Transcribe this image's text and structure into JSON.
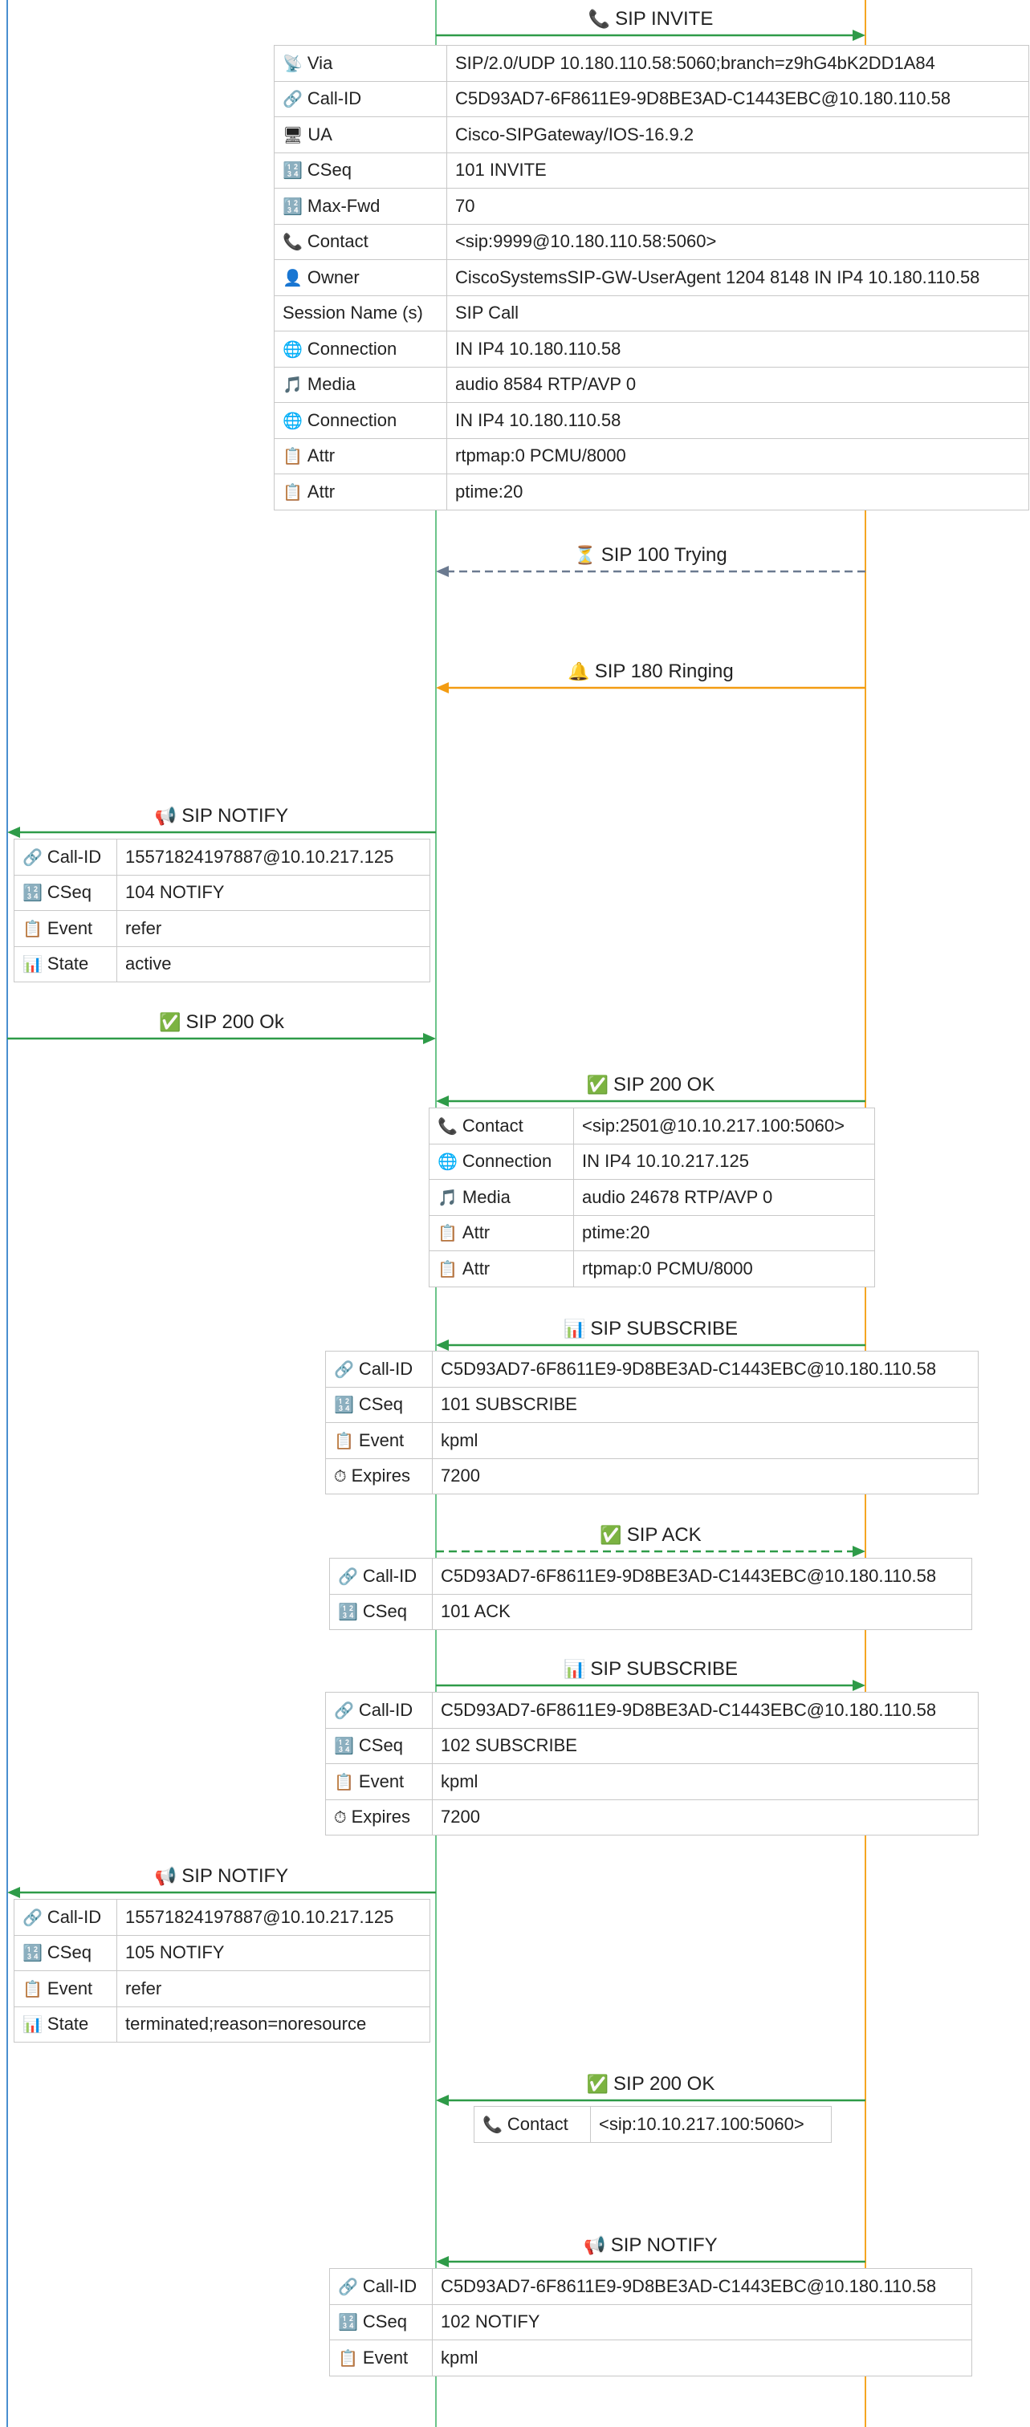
{
  "colors": {
    "left_lifeline": "#4a8fd0",
    "middle_lifeline": "#6cc48a",
    "right_lifeline": "#f5a623",
    "green": "#2e9b48",
    "gray": "#6b7a90",
    "orange": "#f39c12"
  },
  "messages": [
    {
      "id": "m1",
      "label": "SIP INVITE",
      "icon": "phone-icon",
      "glyph": "📞",
      "from": "middle",
      "to": "right",
      "style": "solid",
      "color": "#2e9b48",
      "fields": [
        {
          "icon": "satellite-icon",
          "glyph": "📡",
          "key": "Via",
          "value": "SIP/2.0/UDP 10.180.110.58:5060;branch=z9hG4bK2DD1A84"
        },
        {
          "icon": "link-icon",
          "glyph": "🔗",
          "key": "Call-ID",
          "value": "C5D93AD7-6F8611E9-9D8BE3AD-C1443EBC@10.180.110.58"
        },
        {
          "icon": "computer-icon",
          "glyph": "🖥",
          "key": "UA",
          "value": "Cisco-SIPGateway/IOS-16.9.2"
        },
        {
          "icon": "numbers-icon",
          "glyph": "🔢",
          "key": "CSeq",
          "value": "101 INVITE"
        },
        {
          "icon": "numbers-icon",
          "glyph": "🔢",
          "key": "Max-Fwd",
          "value": "70"
        },
        {
          "icon": "phone-icon",
          "glyph": "📞",
          "key": "Contact",
          "value": "<sip:9999@10.180.110.58:5060>"
        },
        {
          "icon": "person-icon",
          "glyph": "👤",
          "key": "Owner",
          "value": "CiscoSystemsSIP-GW-UserAgent 1204 8148 IN IP4 10.180.110.58"
        },
        {
          "icon": "",
          "glyph": "",
          "key": "Session Name (s)",
          "value": "SIP Call"
        },
        {
          "icon": "globe-icon",
          "glyph": "🌐",
          "key": "Connection",
          "value": "IN IP4 10.180.110.58"
        },
        {
          "icon": "music-icon",
          "glyph": "🎵",
          "key": "Media",
          "value": "audio 8584 RTP/AVP 0"
        },
        {
          "icon": "globe-icon",
          "glyph": "🌐",
          "key": "Connection",
          "value": "IN IP4 10.180.110.58"
        },
        {
          "icon": "clipboard-icon",
          "glyph": "📋",
          "key": "Attr",
          "value": "rtpmap:0 PCMU/8000"
        },
        {
          "icon": "clipboard-icon",
          "glyph": "📋",
          "key": "Attr",
          "value": "ptime:20"
        }
      ]
    },
    {
      "id": "m2",
      "label": "SIP 100 Trying",
      "icon": "hourglass-icon",
      "glyph": "⏳",
      "from": "right",
      "to": "middle",
      "style": "dashed",
      "color": "#6b7a90",
      "fields": []
    },
    {
      "id": "m3",
      "label": "SIP 180 Ringing",
      "icon": "bell-icon",
      "glyph": "🔔",
      "from": "right",
      "to": "middle",
      "style": "solid",
      "color": "#f39c12",
      "fields": []
    },
    {
      "id": "m4",
      "label": "SIP NOTIFY",
      "icon": "megaphone-icon",
      "glyph": "📢",
      "from": "middle",
      "to": "left",
      "style": "solid",
      "color": "#2e9b48",
      "fields": [
        {
          "icon": "link-icon",
          "glyph": "🔗",
          "key": "Call-ID",
          "value": "15571824197887@10.10.217.125"
        },
        {
          "icon": "numbers-icon",
          "glyph": "🔢",
          "key": "CSeq",
          "value": "104 NOTIFY"
        },
        {
          "icon": "clipboard-icon",
          "glyph": "📋",
          "key": "Event",
          "value": "refer"
        },
        {
          "icon": "chart-icon",
          "glyph": "📊",
          "key": "State",
          "value": "active"
        }
      ]
    },
    {
      "id": "m5",
      "label": "SIP 200 Ok",
      "icon": "check-icon",
      "glyph": "✅",
      "from": "left",
      "to": "middle",
      "style": "solid",
      "color": "#2e9b48",
      "fields": []
    },
    {
      "id": "m6",
      "label": "SIP 200 OK",
      "icon": "check-icon",
      "glyph": "✅",
      "from": "right",
      "to": "middle",
      "style": "solid",
      "color": "#2e9b48",
      "fields": [
        {
          "icon": "phone-icon",
          "glyph": "📞",
          "key": "Contact",
          "value": "<sip:2501@10.10.217.100:5060>"
        },
        {
          "icon": "globe-icon",
          "glyph": "🌐",
          "key": "Connection",
          "value": "IN IP4 10.10.217.125"
        },
        {
          "icon": "music-icon",
          "glyph": "🎵",
          "key": "Media",
          "value": "audio 24678 RTP/AVP 0"
        },
        {
          "icon": "clipboard-icon",
          "glyph": "📋",
          "key": "Attr",
          "value": "ptime:20"
        },
        {
          "icon": "clipboard-icon",
          "glyph": "📋",
          "key": "Attr",
          "value": "rtpmap:0 PCMU/8000"
        }
      ]
    },
    {
      "id": "m7",
      "label": "SIP SUBSCRIBE",
      "icon": "chart-icon",
      "glyph": "📊",
      "from": "right",
      "to": "middle",
      "style": "solid",
      "color": "#2e9b48",
      "fields": [
        {
          "icon": "link-icon",
          "glyph": "🔗",
          "key": "Call-ID",
          "value": "C5D93AD7-6F8611E9-9D8BE3AD-C1443EBC@10.180.110.58"
        },
        {
          "icon": "numbers-icon",
          "glyph": "🔢",
          "key": "CSeq",
          "value": "101 SUBSCRIBE"
        },
        {
          "icon": "clipboard-icon",
          "glyph": "📋",
          "key": "Event",
          "value": "kpml"
        },
        {
          "icon": "stopwatch-icon",
          "glyph": "⏱",
          "key": "Expires",
          "value": "7200"
        }
      ]
    },
    {
      "id": "m8",
      "label": "SIP ACK",
      "icon": "check-icon",
      "glyph": "✅",
      "from": "middle",
      "to": "right",
      "style": "dashed",
      "color": "#2e9b48",
      "fields": [
        {
          "icon": "link-icon",
          "glyph": "🔗",
          "key": "Call-ID",
          "value": "C5D93AD7-6F8611E9-9D8BE3AD-C1443EBC@10.180.110.58"
        },
        {
          "icon": "numbers-icon",
          "glyph": "🔢",
          "key": "CSeq",
          "value": "101 ACK"
        }
      ]
    },
    {
      "id": "m9",
      "label": "SIP SUBSCRIBE",
      "icon": "chart-icon",
      "glyph": "📊",
      "from": "middle",
      "to": "right",
      "style": "solid",
      "color": "#2e9b48",
      "fields": [
        {
          "icon": "link-icon",
          "glyph": "🔗",
          "key": "Call-ID",
          "value": "C5D93AD7-6F8611E9-9D8BE3AD-C1443EBC@10.180.110.58"
        },
        {
          "icon": "numbers-icon",
          "glyph": "🔢",
          "key": "CSeq",
          "value": "102 SUBSCRIBE"
        },
        {
          "icon": "clipboard-icon",
          "glyph": "📋",
          "key": "Event",
          "value": "kpml"
        },
        {
          "icon": "stopwatch-icon",
          "glyph": "⏱",
          "key": "Expires",
          "value": "7200"
        }
      ]
    },
    {
      "id": "m10",
      "label": "SIP NOTIFY",
      "icon": "megaphone-icon",
      "glyph": "📢",
      "from": "middle",
      "to": "left",
      "style": "solid",
      "color": "#2e9b48",
      "fields": [
        {
          "icon": "link-icon",
          "glyph": "🔗",
          "key": "Call-ID",
          "value": "15571824197887@10.10.217.125"
        },
        {
          "icon": "numbers-icon",
          "glyph": "🔢",
          "key": "CSeq",
          "value": "105 NOTIFY"
        },
        {
          "icon": "clipboard-icon",
          "glyph": "📋",
          "key": "Event",
          "value": "refer"
        },
        {
          "icon": "chart-icon",
          "glyph": "📊",
          "key": "State",
          "value": "terminated;reason=noresource"
        }
      ]
    },
    {
      "id": "m11",
      "label": "SIP 200 OK",
      "icon": "check-icon",
      "glyph": "✅",
      "from": "right",
      "to": "middle",
      "style": "solid",
      "color": "#2e9b48",
      "fields": [
        {
          "icon": "phone-icon",
          "glyph": "📞",
          "key": "Contact",
          "value": "<sip:10.10.217.100:5060>"
        }
      ]
    },
    {
      "id": "m12",
      "label": "SIP NOTIFY",
      "icon": "megaphone-icon",
      "glyph": "📢",
      "from": "right",
      "to": "middle",
      "style": "solid",
      "color": "#2e9b48",
      "fields": [
        {
          "icon": "link-icon",
          "glyph": "🔗",
          "key": "Call-ID",
          "value": "C5D93AD7-6F8611E9-9D8BE3AD-C1443EBC@10.180.110.58"
        },
        {
          "icon": "numbers-icon",
          "glyph": "🔢",
          "key": "CSeq",
          "value": "102 NOTIFY"
        },
        {
          "icon": "clipboard-icon",
          "glyph": "📋",
          "key": "Event",
          "value": "kpml"
        }
      ]
    }
  ]
}
